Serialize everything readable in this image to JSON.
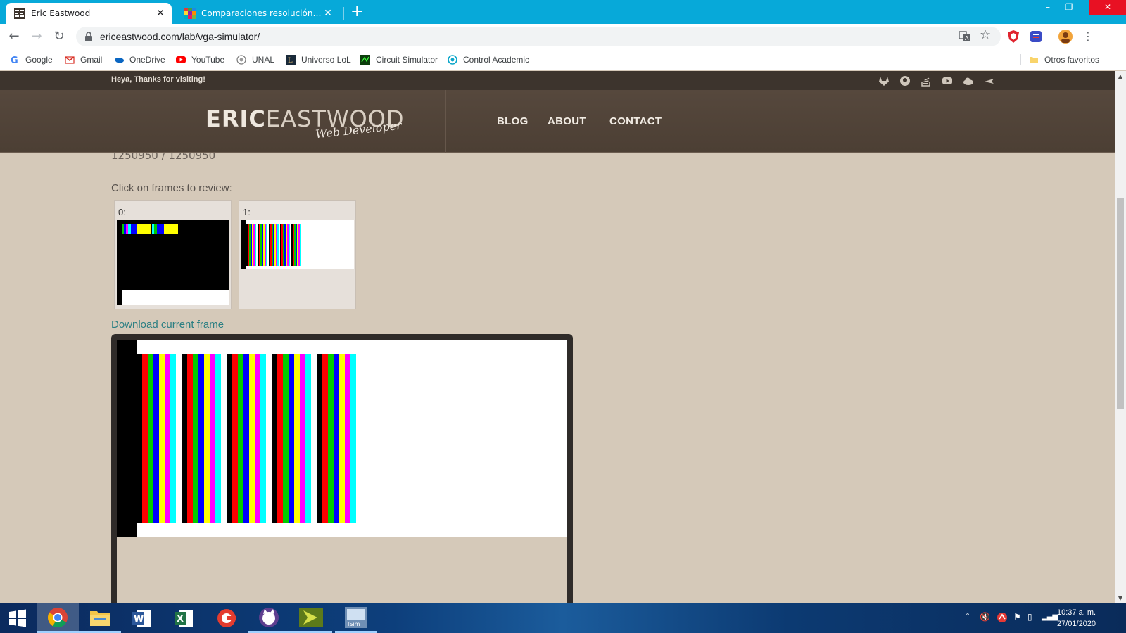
{
  "browser": {
    "tabs": [
      {
        "title": "Eric Eastwood",
        "active": true
      },
      {
        "title": "Comparaciones resolución de la",
        "active": false
      }
    ],
    "new_tab": "+",
    "window_controls": {
      "minimize": "–",
      "restore": "❐",
      "close": "✕"
    },
    "address": "ericeastwood.com/lab/vga-simulator/",
    "bookmarks": [
      "Google",
      "Gmail",
      "OneDrive",
      "YouTube",
      "UNAL",
      "Universo LoL",
      "Circuit Simulator",
      "Control Academic"
    ],
    "other_bookmarks": "Otros favoritos"
  },
  "site": {
    "greeting": "Heya, Thanks for visiting!",
    "logo_strong": "ERIC",
    "logo_light": "EASTWOOD",
    "logo_sub": "Web Developer",
    "nav": [
      "BLOG",
      "ABOUT",
      "CONTACT"
    ],
    "social_icons": [
      "gitlab-icon",
      "github-icon",
      "stackoverflow-icon",
      "youtube-icon",
      "cloud-icon",
      "rocket-icon"
    ]
  },
  "content": {
    "cut_text": "1250950 / 1250950",
    "hint": "Click on frames to review:",
    "frames": [
      {
        "label": "0:"
      },
      {
        "label": "1:"
      }
    ],
    "download_label": "Download current frame",
    "colors": {
      "page_bg": "#d5c9b9",
      "header_bg": "#4f4237",
      "link": "#2b7f83",
      "stripes": [
        "#000000",
        "#ff0000",
        "#00cc00",
        "#0000ff",
        "#ffff00",
        "#ff00ff",
        "#00ffff"
      ]
    }
  },
  "taskbar": {
    "apps": [
      "start-button",
      "chrome-icon",
      "file-explorer-icon",
      "word-icon",
      "excel-icon",
      "ccleaner-icon",
      "cat-app-icon",
      "xilinx-icon",
      "isim-icon"
    ],
    "clock_time": "10:37 a. m.",
    "clock_date": "27/01/2020"
  }
}
